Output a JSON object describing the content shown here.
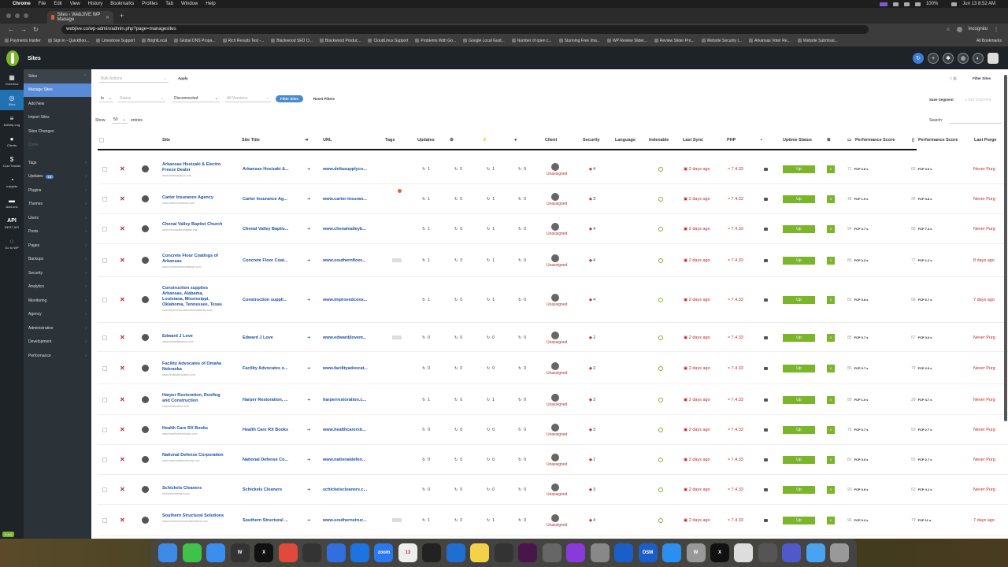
{
  "macbar": {
    "app": "Chrome",
    "menus": [
      "File",
      "Edit",
      "View",
      "History",
      "Bookmarks",
      "Profiles",
      "Tab",
      "Window",
      "Help"
    ],
    "datetime": "Jun 13  8:52 AM",
    "battery": "100%"
  },
  "browser": {
    "tab_title": "Sites ‹ WebJIVE WP Manage",
    "url": "webjive.co/wp-admin/admin.php?page=managesites",
    "incognito": "Incognito",
    "bookmarks": [
      "Payments Insider",
      "Sign in - QuickBoo...",
      "Limestone Support",
      "BrightLocal",
      "Global DNS Propa...",
      "Rich Results Test -...",
      "Blackwood SEO O...",
      "Blackwood Produc...",
      "CloudLinux Support",
      "Problems With Go...",
      "Google Local Guid...",
      "Number of open c...",
      "Stunning Free Ima...",
      "WP Review Slider...",
      "Review Slider Pro...",
      "Website Security |...",
      "Arkansas Voter Re...",
      "Website Submissi..."
    ],
    "all_bookmarks": "All Bookmarks"
  },
  "wp": {
    "title": "Sites",
    "version": "5.4.0"
  },
  "iconbar": [
    {
      "icon": "grid-icon",
      "label": "Overview",
      "glyph": "▦"
    },
    {
      "icon": "globe-icon",
      "label": "Sites",
      "glyph": "◎",
      "active": true
    },
    {
      "icon": "activity-icon",
      "label": "Activity Log",
      "glyph": "≡"
    },
    {
      "icon": "clients-icon",
      "label": "Clients",
      "glyph": "●"
    },
    {
      "icon": "cost-icon",
      "label": "Cost Tracker",
      "glyph": "$"
    },
    {
      "icon": "insights-icon",
      "label": "Insights",
      "glyph": "◔"
    },
    {
      "icon": "add-ons-icon",
      "label": "Add-ons",
      "glyph": "▬"
    },
    {
      "icon": "api-icon",
      "label": "REST API",
      "glyph": "API"
    },
    {
      "icon": "disabled-icon",
      "label": "Go to WP",
      "glyph": "◌"
    }
  ],
  "sidebar": [
    {
      "label": "Sites",
      "arrow": "⌃",
      "style": "head"
    },
    {
      "label": "Manage Sites",
      "style": "active"
    },
    {
      "label": "Add New"
    },
    {
      "label": "Import Sites"
    },
    {
      "label": "Sites Changes"
    },
    {
      "label": "Clone",
      "style": "dim"
    },
    {
      "label": "Tags",
      "arrow": "›"
    },
    {
      "label": "Updates",
      "badge": "18",
      "arrow": "›"
    },
    {
      "label": "Plugins",
      "arrow": "›"
    },
    {
      "label": "Themes",
      "arrow": "›"
    },
    {
      "label": "Users",
      "arrow": "›"
    },
    {
      "label": "Posts",
      "arrow": "›"
    },
    {
      "label": "Pages",
      "arrow": "›"
    },
    {
      "label": "Backups",
      "arrow": "›"
    },
    {
      "label": "Security",
      "arrow": "›"
    },
    {
      "label": "Analytics",
      "arrow": "›"
    },
    {
      "label": "Monitoring",
      "arrow": "›"
    },
    {
      "label": "Agency",
      "arrow": "›"
    },
    {
      "label": "Administrative",
      "arrow": "›"
    },
    {
      "label": "Development",
      "arrow": "›"
    },
    {
      "label": "Performance",
      "arrow": "›"
    }
  ],
  "filters": {
    "bulk_placeholder": "Bulk Actions",
    "apply": "Apply",
    "is": "Is",
    "status_placeholder": "Status",
    "disconnected": "Disconnected",
    "version_placeholder": "All Versions",
    "filter_sites": "Filter Sites",
    "reset_filters": "Reset Filters",
    "save_segment": "Save Segment",
    "load_segment": "Load Segment",
    "filter_sites_top": "Filter Sites"
  },
  "table": {
    "show": "Show",
    "entries_value": "50",
    "entries": "entries",
    "search": "Search:",
    "columns": [
      "Site",
      "Site Title",
      "URL",
      "Tags",
      "Updates",
      "Client",
      "Security",
      "Language",
      "Indexable",
      "Last Sync",
      "PHP",
      "Uptime Status",
      "Performance Score",
      "Performance Score",
      "Last Purge"
    ],
    "rows": [
      {
        "name": "Arkansas Hosizaki & Electro Freeze Dealer",
        "surl": "www.deltasupplyco.com",
        "title": "Arkansas Hosizaki &...",
        "url": "www.deltasupplyco...",
        "u": [
          "1",
          "0",
          "1",
          "0"
        ],
        "client": "Unassigned",
        "sec": "4",
        "sync": "2 days ago",
        "php": "7.4.33",
        "up": "Up",
        "g": "0",
        "p1": "71",
        "f1": "FCP 0.8 s",
        "p2": "63",
        "f2": "FCP 3.9 s",
        "purge": "Never Purg",
        "tag": false
      },
      {
        "name": "Carter Insurance Agency",
        "surl": "www.carter-insurance.com",
        "title": "Carter Insurance Ag...",
        "url": "www.carter-insuran...",
        "u": [
          "1",
          "0",
          "1",
          "0"
        ],
        "client": "Unassigned",
        "sec": "3",
        "sync": "2 days ago",
        "php": "7.4.33",
        "up": "Up",
        "g": "0",
        "p1": "48",
        "f1": "FCP 1.0 s",
        "p2": "34",
        "f2": "FCP 3.8 s",
        "purge": "Never Purg",
        "tag": false
      },
      {
        "name": "Chenal Valley Baptist Church",
        "surl": "www.chenalvalleybaptist.org",
        "title": "Chenal Valley Baptis...",
        "url": "www.chenalvalleyb...",
        "u": [
          "1",
          "0",
          "1",
          "0"
        ],
        "client": "Unassigned",
        "sec": "4",
        "sync": "2 days ago",
        "php": "7.4.33",
        "up": "Up",
        "g": "0",
        "p1": "94",
        "f1": "FCP 0.7 s",
        "p2": "58",
        "f2": "FCP 7.4 s",
        "purge": "Never Purg",
        "tag": false
      },
      {
        "name": "Concrete Floor Coatings of Arkansas",
        "surl": "www.southernfloorcoatings.com",
        "title": "Concrete Floor Coat...",
        "url": "www.southernfloor...",
        "u": [
          "1",
          "0",
          "1",
          "0"
        ],
        "client": "Unassigned",
        "sec": "4",
        "sync": "2 days ago",
        "php": "7.4.33",
        "up": "Up",
        "g": "0",
        "p1": "86",
        "f1": "FCP 0.3 s",
        "p2": "77",
        "f2": "FCP 1.2 s",
        "purge": "8 days ago",
        "tag": true
      },
      {
        "name": "Construction supplies Arkansas, Alabama, Louisiana, Mississippi, Oklahoma, Tennessee, Texas",
        "surl": "www.improvedconstructionmaterials.com",
        "title": "Construction suppli...",
        "url": "www.improvedcons...",
        "u": [
          "1",
          "0",
          "1",
          "0"
        ],
        "client": "Unassigned",
        "sec": "4",
        "sync": "2 days ago",
        "php": "7.4.33",
        "up": "Up",
        "g": "0",
        "p1": "82",
        "f1": "FCP 0.8 s",
        "p2": "58",
        "f2": "FCP 6.7 s",
        "purge": "7 days ago",
        "tag": false
      },
      {
        "name": "Edward J Love",
        "surl": "www.edwardjlovemd.com",
        "title": "Edward J Love",
        "url": "www.edwardjlovem...",
        "u": [
          "0",
          "0",
          "0",
          "0"
        ],
        "client": "Unassigned",
        "sec": "2",
        "sync": "2 days ago",
        "php": "7.4.33",
        "up": "Up",
        "g": "0",
        "p1": "85",
        "f1": "FCP 0.7 s",
        "p2": "67",
        "f2": "FCP 3.0 s",
        "purge": "Never Purg",
        "tag": true
      },
      {
        "name": "Facility Advocates of Omaha Nebraska",
        "surl": "www.facilityadvocates.com",
        "title": "Facility Advocates o...",
        "url": "www.facilityadvocat...",
        "u": [
          "0",
          "0",
          "0",
          "0"
        ],
        "client": "Unassigned",
        "sec": "2",
        "sync": "2 days ago",
        "php": "7.4.33",
        "up": "Up",
        "g": "0",
        "p1": "86",
        "f1": "FCP 0.7 s",
        "p2": "79",
        "f2": "FCP 2.9 s",
        "purge": "Never Purg",
        "tag": false
      },
      {
        "name": "Harper Restoration, Roofing and Construction",
        "surl": "harperrestoration.com",
        "title": "Harper Restoration, ...",
        "url": "harperrestoration.c...",
        "u": [
          "1",
          "0",
          "1",
          "0"
        ],
        "client": "Unassigned",
        "sec": "3",
        "sync": "2 days ago",
        "php": "7.4.33",
        "up": "Up",
        "g": "0",
        "p1": "89",
        "f1": "FCP 1.0 s",
        "p2": "39",
        "f2": "FCP 4.7 s",
        "purge": "Never Purg",
        "tag": false
      },
      {
        "name": "Health Care RX Books",
        "surl": "www.healthcarerxbooks.com",
        "title": "Health Care RX Books",
        "url": "www.healthcarerxb...",
        "u": [
          "0",
          "0",
          "0",
          "0"
        ],
        "client": "Unassigned",
        "sec": "3",
        "sync": "2 days ago",
        "php": "7.4.33",
        "up": "Up",
        "g": "0",
        "p1": "75",
        "f1": "FCP 0.7 s",
        "p2": "59",
        "f2": "FCP 2.7 s",
        "purge": "Never Purg",
        "tag": false
      },
      {
        "name": "National Defense Corporation",
        "surl": "www.nationaldefensecorp.com",
        "title": "National Defense Co...",
        "url": "www.nationaldefen...",
        "u": [
          "0",
          "0",
          "0",
          "0"
        ],
        "client": "Unassigned",
        "sec": "2",
        "sync": "2 days ago",
        "php": "7.4.33",
        "up": "Up",
        "g": "0",
        "p1": "82",
        "f1": "FCP 0.6 s",
        "p2": "55",
        "f2": "FCP 2.7 s",
        "purge": "Never Purg",
        "tag": false
      },
      {
        "name": "Schickels Cleaners",
        "surl": "schickelscleaners.com",
        "title": "Schickels Cleaners",
        "url": "schickelscleaners.c...",
        "u": [
          "0",
          "0",
          "0",
          "0"
        ],
        "client": "Unassigned",
        "sec": "3",
        "sync": "2 days ago",
        "php": "7.4.33",
        "up": "Up",
        "g": "0",
        "p1": "93",
        "f1": "FCP 0.8 s",
        "p2": "63",
        "f2": "FCP 4.1 s",
        "purge": "Never Purg",
        "tag": false
      },
      {
        "name": "Southern Structural Solutions",
        "surl": "www.southernstructuralsolutions.com",
        "title": "Southern Structural ...",
        "url": "www.southernstruc...",
        "u": [
          "1",
          "0",
          "1",
          "0"
        ],
        "client": "Unassigned",
        "sec": "4",
        "sync": "2 days ago",
        "php": "7.4.33",
        "up": "Up",
        "g": "0",
        "p1": "96",
        "f1": "FCP 0.3 s",
        "p2": "79",
        "f2": "FCP 11 s",
        "purge": "7 days ago",
        "tag": true
      }
    ]
  },
  "dock": [
    {
      "icon": "finder-icon",
      "color": "#3d8be6",
      "t": ""
    },
    {
      "icon": "messages-icon",
      "color": "#3ec24a",
      "t": ""
    },
    {
      "icon": "mail-icon",
      "color": "#3a8ef0",
      "t": ""
    },
    {
      "icon": "word-icon",
      "color": "#333",
      "t": "W"
    },
    {
      "icon": "x-icon",
      "color": "#111",
      "t": "X"
    },
    {
      "icon": "chrome-icon",
      "color": "#e04a3a",
      "t": ""
    },
    {
      "icon": "rss-icon",
      "color": "#333",
      "t": ""
    },
    {
      "icon": "messenger-icon",
      "color": "#2f6fe0",
      "t": ""
    },
    {
      "icon": "bluesky-icon",
      "color": "#1d74e0",
      "t": ""
    },
    {
      "icon": "zoom-icon",
      "color": "#2a78f0",
      "t": "zoom"
    },
    {
      "icon": "calendar-icon",
      "color": "#eee",
      "t": "13"
    },
    {
      "icon": "chatgpt-icon",
      "color": "#222",
      "t": ""
    },
    {
      "icon": "vscode-icon",
      "color": "#1f6fd0",
      "t": ""
    },
    {
      "icon": "notes-icon",
      "color": "#f3d24a",
      "t": ""
    },
    {
      "icon": "mission-icon",
      "color": "#333",
      "t": ""
    },
    {
      "icon": "slack-icon",
      "color": "#4a154b",
      "t": ""
    },
    {
      "icon": "keychain-icon",
      "color": "#666",
      "t": ""
    },
    {
      "icon": "podcast-icon",
      "color": "#8a3ad8",
      "t": ""
    },
    {
      "icon": "preview-icon",
      "color": "#888",
      "t": ""
    },
    {
      "icon": "xcode-icon",
      "color": "#1a5fc8",
      "t": ""
    },
    {
      "icon": "dsm-icon",
      "color": "#1a5fc8",
      "t": "DSM"
    },
    {
      "icon": "safari-icon",
      "color": "#2b8ff0",
      "t": ""
    },
    {
      "icon": "w-app-icon",
      "color": "#999",
      "t": "W"
    },
    {
      "icon": "x2-icon",
      "color": "#111",
      "t": "X"
    },
    {
      "icon": "script-icon",
      "color": "#ddd",
      "t": ""
    },
    {
      "icon": "printer-icon",
      "color": "#555",
      "t": ""
    },
    {
      "icon": "teams-icon",
      "color": "#5059c9",
      "t": ""
    },
    {
      "icon": "folder-icon",
      "color": "#4aa3f0",
      "t": ""
    },
    {
      "icon": "trash-icon",
      "color": "#999",
      "t": ""
    }
  ]
}
